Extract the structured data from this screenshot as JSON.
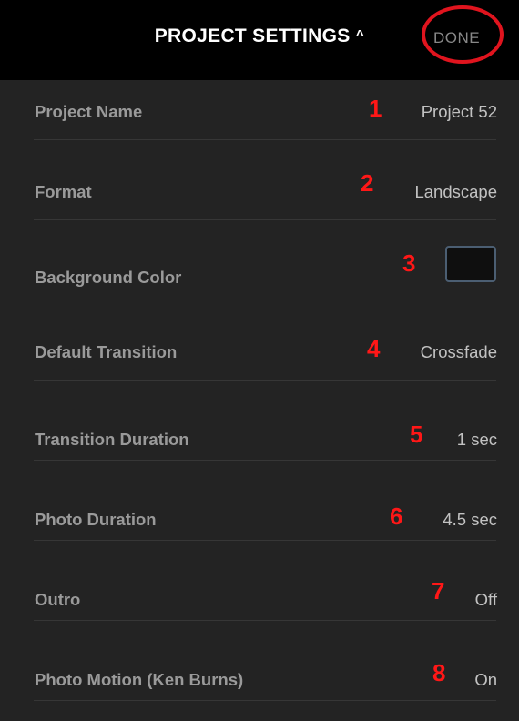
{
  "header": {
    "title": "PROJECT SETTINGS",
    "caret": "^",
    "done_label": "DONE",
    "done_circle_color": "#e0141e"
  },
  "settings": [
    {
      "number": "1",
      "label": "Project Name",
      "value": "Project 52"
    },
    {
      "number": "2",
      "label": "Format",
      "value": "Landscape"
    },
    {
      "number": "3",
      "label": "Background Color",
      "value": "",
      "swatch_color": "#0f0f0f"
    },
    {
      "number": "4",
      "label": "Default Transition",
      "value": "Crossfade"
    },
    {
      "number": "5",
      "label": "Transition Duration",
      "value": "1 sec"
    },
    {
      "number": "6",
      "label": "Photo Duration",
      "value": "4.5 sec"
    },
    {
      "number": "7",
      "label": "Outro",
      "value": "Off"
    },
    {
      "number": "8",
      "label": "Photo Motion (Ken Burns)",
      "value": "On"
    }
  ],
  "colors": {
    "background": "#232323",
    "header_background": "#000000",
    "annotation_red": "#ff1717"
  }
}
